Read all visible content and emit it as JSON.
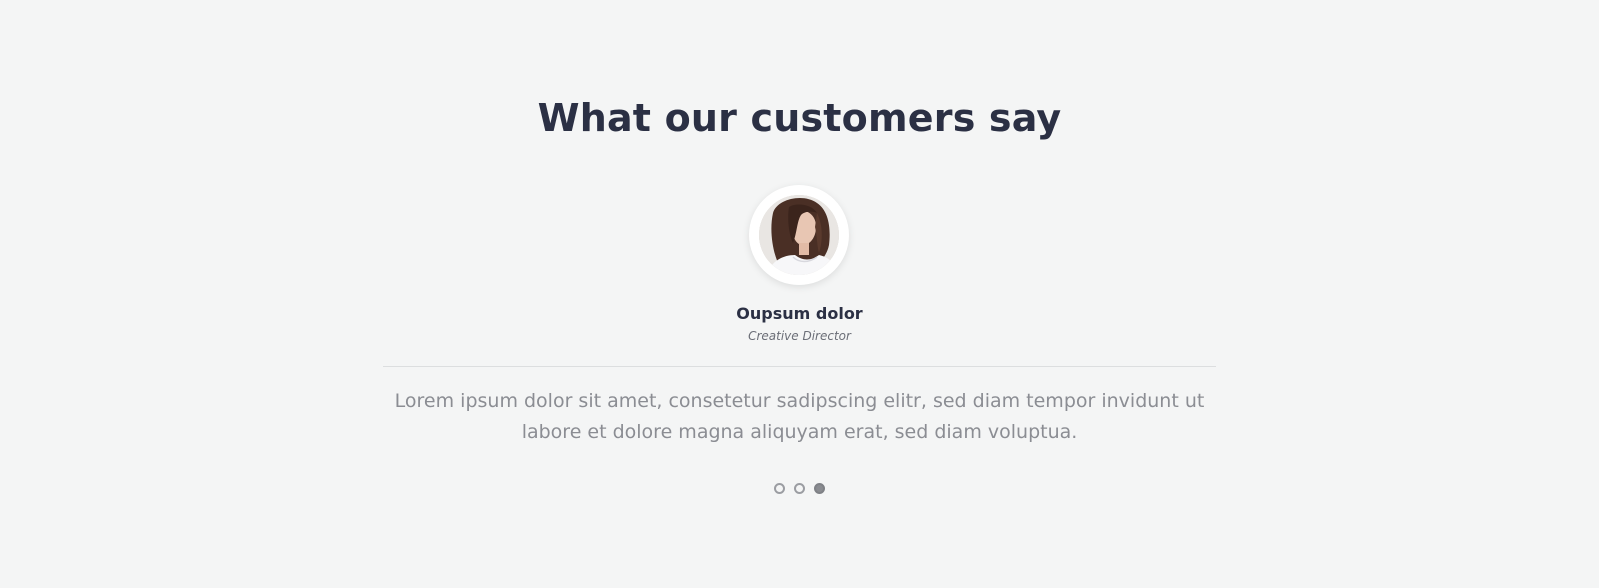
{
  "section": {
    "title": "What our customers say"
  },
  "testimonial": {
    "avatar_alt": "woman portrait photo",
    "name": "Oupsum dolor",
    "role": "Creative Director",
    "quote": "Lorem ipsum dolor sit amet, consetetur sadipscing elitr, sed diam tempor invidunt ut labore et dolore magna aliquyam erat, sed diam voluptua."
  },
  "pagination": {
    "count": 3,
    "active_index": 2
  },
  "colors": {
    "background": "#f4f5f5",
    "heading": "#2b3044",
    "body_text": "#8b8d93"
  }
}
